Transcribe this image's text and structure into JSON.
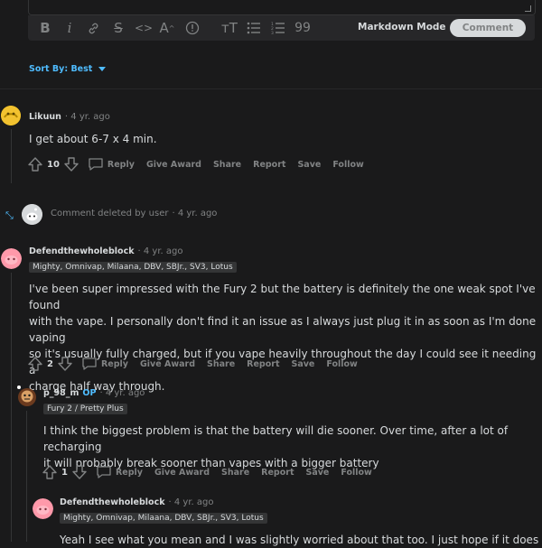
{
  "editor": {
    "toolbar_icons": [
      "bold-icon",
      "italic-icon",
      "link-icon",
      "strikethrough-icon",
      "inline-code-icon",
      "superscript-icon",
      "spoiler-icon",
      "heading-icon",
      "bulleted-list-icon",
      "numbered-list-icon",
      "quote-block-icon"
    ],
    "markdown_mode_label": "Markdown Mode",
    "comment_button_label": "Comment"
  },
  "sort": {
    "label": "Sort By: Best"
  },
  "comments": [
    {
      "author": "Likuun",
      "time": "· 4 yr. ago",
      "body": "I get about 6-7 x 4 min.",
      "votes": "10",
      "actions": [
        "Reply",
        "Give Award",
        "Share",
        "Report",
        "Save",
        "Follow"
      ]
    },
    {
      "deleted_text": "Comment deleted by user",
      "time": "· 4 yr. ago"
    },
    {
      "author": "Defendthewholeblock",
      "time": "· 4 yr. ago",
      "flair": "Mighty, Omnivap, Milaana, DBV, SBJr., SV3, Lotus",
      "body_lines": [
        "I've been super impressed with the Fury 2 but the battery is definitely the one weak spot I've found",
        "with the vape. I personally don't find it an issue as I always just plug it in as soon as I'm done vaping",
        "so it's usually fully charged, but if you vape heavily throughout the day I could see it needing a",
        "charge half way through."
      ],
      "votes": "2",
      "actions": [
        "Reply",
        "Give Award",
        "Share",
        "Report",
        "Save",
        "Follow"
      ]
    },
    {
      "author": "p_98_m",
      "op": "OP",
      "time": "· 4 yr. ago",
      "flair": "Fury 2 / Pretty Plus",
      "body_lines": [
        "I think the biggest problem is that the battery will die sooner. Over time, after a lot of recharging",
        "it will probably break sooner than vapes with a bigger battery"
      ],
      "votes": "1",
      "actions": [
        "Reply",
        "Give Award",
        "Share",
        "Report",
        "Save",
        "Follow"
      ]
    },
    {
      "author": "Defendthewholeblock",
      "time": "· 4 yr. ago",
      "flair": "Mighty, Omnivap, Milaana, DBV, SBJr., SV3, Lotus",
      "body_partial": "Yeah I see what you mean and I was slightly worried about that too. I just hope if it does die"
    }
  ],
  "colors": {
    "accent": "#4fbcff",
    "background": "#1a1a1b",
    "text": "#d7dadc",
    "muted": "#818384"
  }
}
